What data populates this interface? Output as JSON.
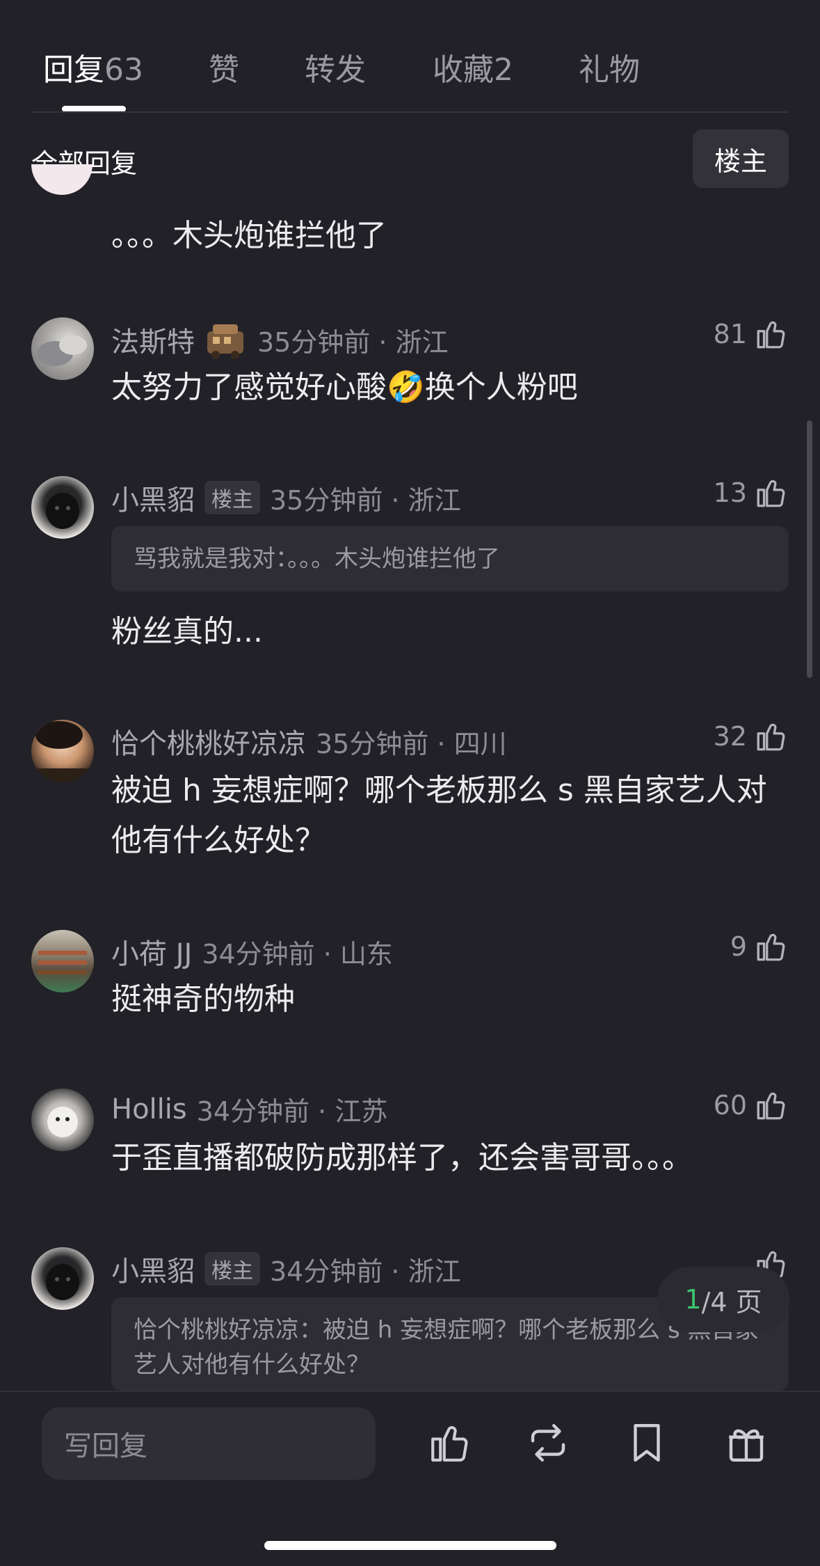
{
  "tabs": [
    {
      "label": "回复",
      "count": "63"
    },
    {
      "label": "赞",
      "count": ""
    },
    {
      "label": "转发",
      "count": ""
    },
    {
      "label": "收藏",
      "count": "2"
    },
    {
      "label": "礼物",
      "count": ""
    }
  ],
  "filter": {
    "label": "全部回复",
    "author_button": "楼主"
  },
  "partial_comment": {
    "text": "。。。木头炮谁拦他了"
  },
  "comments": [
    {
      "name": "法斯特",
      "badge": "",
      "time": "35分钟前 · 浙江",
      "likes": "81",
      "quote": "",
      "text": "太努力了感觉好心酸🤣换个人粉吧"
    },
    {
      "name": "小黑貂",
      "badge": "楼主",
      "time": "35分钟前 · 浙江",
      "likes": "13",
      "quote": "骂我就是我对：。。。木头炮谁拦他了",
      "text": "粉丝真的..."
    },
    {
      "name": "恰个桃桃好凉凉",
      "badge": "",
      "time": "35分钟前 · 四川",
      "likes": "32",
      "quote": "",
      "text": "被迫 h 妄想症啊？哪个老板那么 s 黑自家艺人对他有什么好处？"
    },
    {
      "name": "小荷 JJ",
      "badge": "",
      "time": "34分钟前 · 山东",
      "likes": "9",
      "quote": "",
      "text": "挺神奇的物种"
    },
    {
      "name": "Hollis",
      "badge": "",
      "time": "34分钟前 · 江苏",
      "likes": "60",
      "quote": "",
      "text": "于歪直播都破防成那样了，还会害哥哥。。。"
    },
    {
      "name": "小黑貂",
      "badge": "楼主",
      "time": "34分钟前 · 浙江",
      "likes": "",
      "quote": "恰个桃桃好凉凉：被迫 h 妄想症啊？哪个老板那么 s 黑自家艺人对他有什么好处？",
      "text": ""
    }
  ],
  "pagination": {
    "current": "1",
    "rest": "/4 页"
  },
  "bottom_bar": {
    "reply_placeholder": "写回复"
  }
}
